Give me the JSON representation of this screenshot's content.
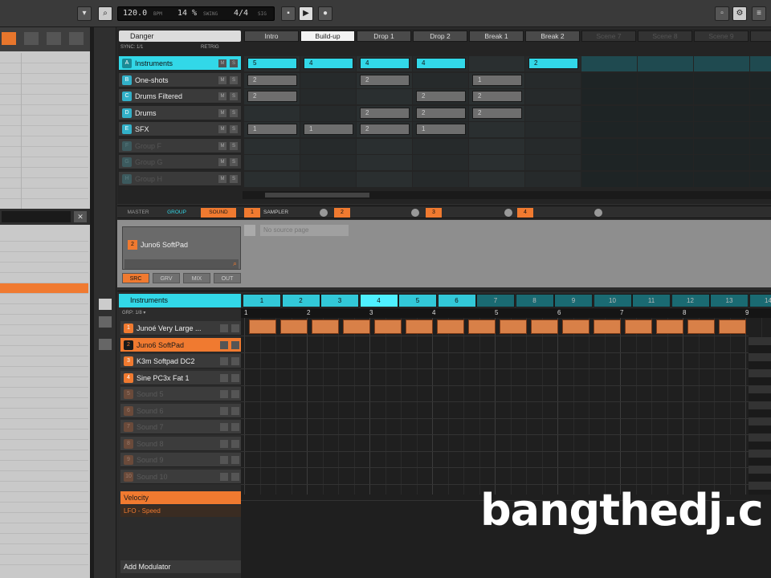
{
  "transport": {
    "tempo": "120.0",
    "tempo_unit": "BPM",
    "swing": "14 %",
    "swing_label": "SWING",
    "signature": "4/4",
    "signature_label": "SIG"
  },
  "arranger": {
    "project_name": "Danger",
    "sync_label": "SYNC: 1/1",
    "retrig_label": "RETRIG",
    "scenes": [
      "Intro",
      "Build-up",
      "Drop 1",
      "Drop 2",
      "Break 1",
      "Break 2",
      "Scene 7",
      "Scene 8",
      "Scene 9",
      "Sc"
    ],
    "active_scene": 1,
    "groups": [
      {
        "letter": "A",
        "name": "Instruments"
      },
      {
        "letter": "B",
        "name": "One-shots"
      },
      {
        "letter": "C",
        "name": "Drums Filtered"
      },
      {
        "letter": "D",
        "name": "Drums"
      },
      {
        "letter": "E",
        "name": "SFX"
      },
      {
        "letter": "F",
        "name": "Group F"
      },
      {
        "letter": "G",
        "name": "Group G"
      },
      {
        "letter": "H",
        "name": "Group H"
      }
    ],
    "clips": [
      {
        "row": 0,
        "col": 0,
        "label": "5"
      },
      {
        "row": 0,
        "col": 1,
        "label": "4"
      },
      {
        "row": 0,
        "col": 2,
        "label": "4"
      },
      {
        "row": 0,
        "col": 3,
        "label": "4"
      },
      {
        "row": 0,
        "col": 5,
        "label": "2"
      },
      {
        "row": 1,
        "col": 0,
        "label": "2"
      },
      {
        "row": 1,
        "col": 2,
        "label": "2"
      },
      {
        "row": 1,
        "col": 4,
        "label": "1"
      },
      {
        "row": 2,
        "col": 0,
        "label": "2"
      },
      {
        "row": 2,
        "col": 3,
        "label": "2"
      },
      {
        "row": 2,
        "col": 4,
        "label": "2"
      },
      {
        "row": 3,
        "col": 2,
        "label": "2"
      },
      {
        "row": 3,
        "col": 3,
        "label": "2"
      },
      {
        "row": 3,
        "col": 4,
        "label": "2"
      },
      {
        "row": 4,
        "col": 0,
        "label": "1"
      },
      {
        "row": 4,
        "col": 1,
        "label": "1"
      },
      {
        "row": 4,
        "col": 2,
        "label": "2"
      },
      {
        "row": 4,
        "col": 3,
        "label": "1"
      }
    ]
  },
  "tabs": {
    "master": "MASTER",
    "group": "GROUP",
    "sound": "SOUND",
    "slot1": "SAMPLER"
  },
  "sound_panel": {
    "selected_sound_number": "2",
    "selected_sound": "Juno6 SoftPad",
    "no_source": "No source page",
    "buttons": [
      "SRC",
      "GRV",
      "MIX",
      "OUT"
    ]
  },
  "pattern": {
    "group_name": "Instruments",
    "step_label": "GRP: 1/8 ▾",
    "patterns": [
      "1",
      "2",
      "3",
      "4",
      "5",
      "6",
      "7",
      "8",
      "9",
      "10",
      "11",
      "12",
      "13",
      "14"
    ],
    "active_pattern": 3,
    "bar_numbers": [
      "1",
      "2",
      "3",
      "4",
      "5",
      "6",
      "7",
      "8",
      "9"
    ]
  },
  "sounds": [
    {
      "num": "1",
      "name": "Junoé Very Large ..."
    },
    {
      "num": "2",
      "name": "Juno6 SoftPad"
    },
    {
      "num": "3",
      "name": "K3m Softpad DC2"
    },
    {
      "num": "4",
      "name": "Sine PC3x Fat 1"
    },
    {
      "num": "5",
      "name": "Sound 5"
    },
    {
      "num": "6",
      "name": "Sound 6"
    },
    {
      "num": "7",
      "name": "Sound 7"
    },
    {
      "num": "8",
      "name": "Sound 8"
    },
    {
      "num": "9",
      "name": "Sound 9"
    },
    {
      "num": "10",
      "name": "Sound 10"
    }
  ],
  "modulation": {
    "velocity": "Velocity",
    "lfo": "LFO - Speed",
    "add": "Add Modulator"
  },
  "watermark": "bangthedj.c",
  "colors": {
    "accent_orange": "#f07a30",
    "accent_cyan": "#32d8e8"
  }
}
